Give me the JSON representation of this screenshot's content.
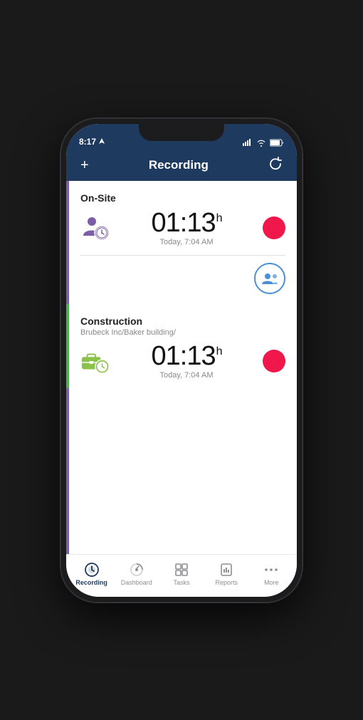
{
  "status": {
    "time": "8:17",
    "location_arrow": "▶",
    "wifi": "wifi",
    "battery": "battery"
  },
  "header": {
    "title": "Recording",
    "add_label": "+",
    "refresh_label": "↺"
  },
  "sections": [
    {
      "id": "onsite",
      "label": "On-Site",
      "sublabel": "",
      "timer": "01:13",
      "timer_unit": "h",
      "timer_sub": "Today, 7:04 AM",
      "icon_type": "person-time",
      "icon_color": "#7b5ea7"
    },
    {
      "id": "construction",
      "label": "Construction",
      "sublabel": "Brubeck Inc/Baker building/",
      "timer": "01:13",
      "timer_unit": "h",
      "timer_sub": "Today, 7:04 AM",
      "icon_type": "briefcase-time",
      "icon_color": "#8bc34a"
    }
  ],
  "tabs": [
    {
      "id": "recording",
      "label": "Recording",
      "icon": "recording",
      "active": true
    },
    {
      "id": "dashboard",
      "label": "Dashboard",
      "icon": "dashboard",
      "active": false
    },
    {
      "id": "tasks",
      "label": "Tasks",
      "icon": "tasks",
      "active": false
    },
    {
      "id": "reports",
      "label": "Reports",
      "icon": "reports",
      "active": false
    },
    {
      "id": "more",
      "label": "More",
      "icon": "more",
      "active": false
    }
  ]
}
